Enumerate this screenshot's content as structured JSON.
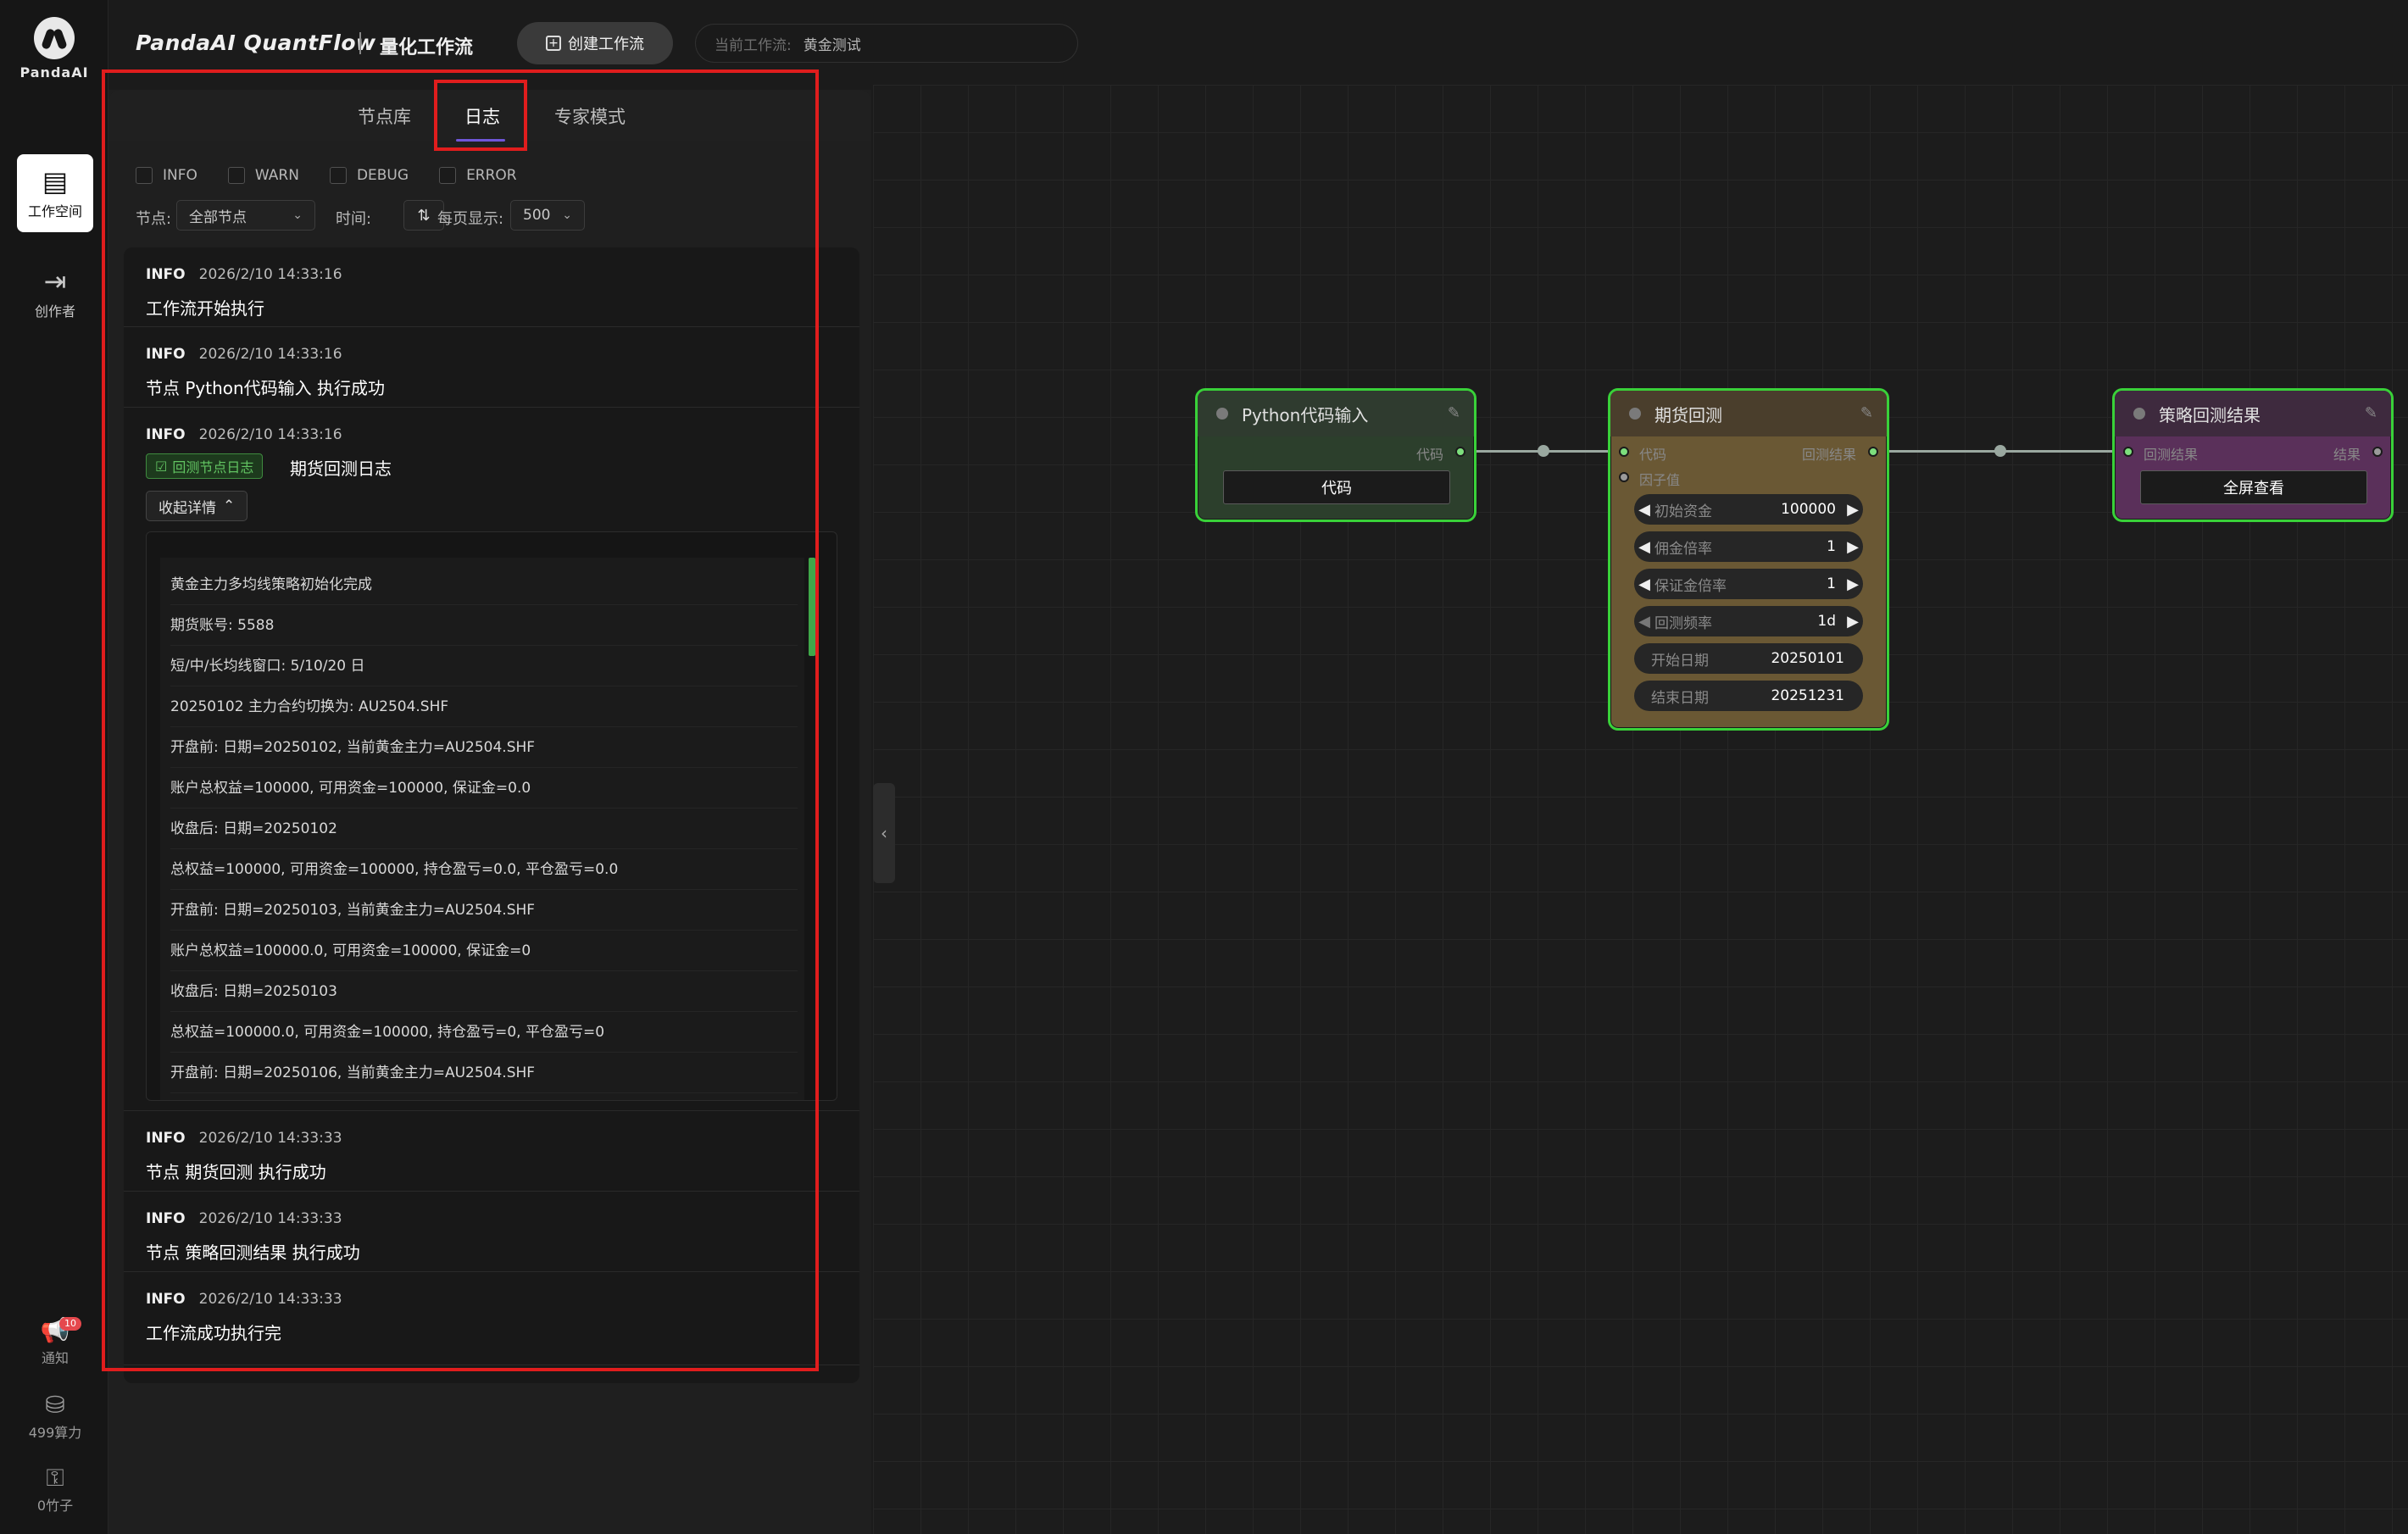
{
  "logo": {
    "text": "PandaAI"
  },
  "rail": {
    "workspace_label": "工作空间",
    "creator_label": "创作者",
    "notify_label": "通知",
    "notify_count": "10",
    "compute_label": "499算力",
    "bamboo_label": "0竹子"
  },
  "header": {
    "app_title": "PandaAI QuantFlow",
    "app_subtitle": "量化工作流",
    "create_button": "创建工作流",
    "current_workflow_label": "当前工作流:",
    "current_workflow_name": "黄金测试"
  },
  "panel": {
    "tabs": [
      {
        "label": "节点库"
      },
      {
        "label": "日志"
      },
      {
        "label": "专家模式"
      }
    ],
    "active_tab": "日志",
    "level_filters": [
      {
        "label": "INFO",
        "checked": false
      },
      {
        "label": "WARN",
        "checked": false
      },
      {
        "label": "DEBUG",
        "checked": false
      },
      {
        "label": "ERROR",
        "checked": false
      }
    ],
    "node_label": "节点:",
    "node_select": "全部节点",
    "time_label": "时间:",
    "page_size_label": "每页显示:",
    "page_size": "500",
    "collapse_button": "收起详情",
    "backtest_tag": "回测节点日志",
    "backtest_tag_title": "期货回测日志"
  },
  "logs": [
    {
      "level": "INFO",
      "time": "2026/2/10 14:33:16",
      "message": "工作流开始执行"
    },
    {
      "level": "INFO",
      "time": "2026/2/10 14:33:16",
      "message": "节点 Python代码输入 执行成功"
    },
    {
      "level": "INFO",
      "time": "2026/2/10 14:33:16",
      "message": ""
    },
    {
      "level": "INFO",
      "time": "2026/2/10 14:33:33",
      "message": "节点 期货回测 执行成功"
    },
    {
      "level": "INFO",
      "time": "2026/2/10 14:33:33",
      "message": "节点 策略回测结果 执行成功"
    },
    {
      "level": "INFO",
      "time": "2026/2/10 14:33:33",
      "message": "工作流成功执行完"
    }
  ],
  "detail_lines": [
    "黄金主力多均线策略初始化完成",
    "期货账号: 5588",
    "短/中/长均线窗口: 5/10/20 日",
    "20250102 主力合约切换为: AU2504.SHF",
    "开盘前: 日期=20250102, 当前黄金主力=AU2504.SHF",
    "账户总权益=100000, 可用资金=100000, 保证金=0.0",
    "收盘后: 日期=20250102",
    "总权益=100000, 可用资金=100000, 持仓盈亏=0.0, 平仓盈亏=0.0",
    "开盘前: 日期=20250103, 当前黄金主力=AU2504.SHF",
    "账户总权益=100000.0, 可用资金=100000, 保证金=0",
    "收盘后: 日期=20250103",
    "总权益=100000.0, 可用资金=100000, 持仓盈亏=0, 平仓盈亏=0",
    "开盘前: 日期=20250106, 当前黄金主力=AU2504.SHF"
  ],
  "nodes": {
    "python": {
      "title": "Python代码输入",
      "out_label": "代码",
      "button": "代码",
      "color": "#2f4a2f"
    },
    "backtest": {
      "title": "期货回测",
      "in_code": "代码",
      "in_factor": "因子值",
      "out_label": "回测结果",
      "color": "#5b4a2c",
      "params": [
        {
          "label": "初始资金",
          "value": "100000"
        },
        {
          "label": "佣金倍率",
          "value": "1"
        },
        {
          "label": "保证金倍率",
          "value": "1"
        },
        {
          "label": "回测频率",
          "value": "1d"
        },
        {
          "label": "开始日期",
          "value": "20250101"
        },
        {
          "label": "结束日期",
          "value": "20251231"
        }
      ]
    },
    "result": {
      "title": "策略回测结果",
      "in_label": "回测结果",
      "out_label": "结果",
      "button": "全屏查看",
      "color": "#4a2a4a"
    }
  }
}
